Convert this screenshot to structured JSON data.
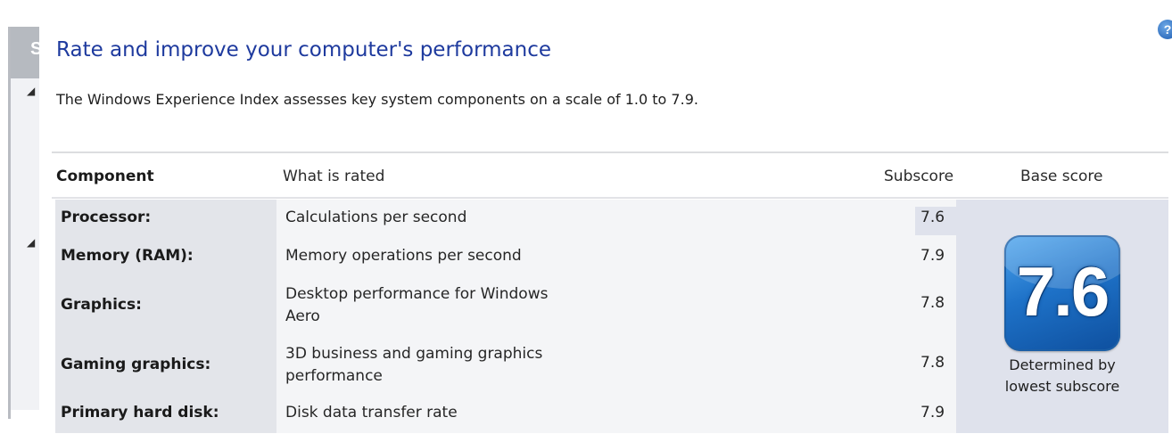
{
  "left_panel": {
    "header_letter": "S",
    "collapse_glyph": "◢"
  },
  "help_icon": {
    "glyph": "?",
    "icon": "help-icon"
  },
  "title": "Rate and improve your computer's performance",
  "description": "The Windows Experience Index assesses key system components on a scale of 1.0 to 7.9.",
  "table": {
    "headers": {
      "component": "Component",
      "what_is_rated": "What is rated",
      "subscore": "Subscore",
      "base_score": "Base score"
    },
    "rows": [
      {
        "component": "Processor:",
        "what_line1": "Calculations per second",
        "what_line2": "",
        "subscore": "7.6"
      },
      {
        "component": "Memory (RAM):",
        "what_line1": "Memory operations per second",
        "what_line2": "",
        "subscore": "7.9"
      },
      {
        "component": "Graphics:",
        "what_line1": "Desktop performance for Windows",
        "what_line2": "Aero",
        "subscore": "7.8"
      },
      {
        "component": "Gaming graphics:",
        "what_line1": "3D business and gaming graphics",
        "what_line2": "performance",
        "subscore": "7.8"
      },
      {
        "component": "Primary hard disk:",
        "what_line1": "Disk data transfer rate",
        "what_line2": "",
        "subscore": "7.9"
      }
    ]
  },
  "base_score": {
    "value": "7.6",
    "caption_line1": "Determined by",
    "caption_line2": "lowest subscore"
  },
  "colors": {
    "title": "#1e3a9e",
    "badge": "#1e72c8",
    "highlight": "#dfe2ec"
  }
}
